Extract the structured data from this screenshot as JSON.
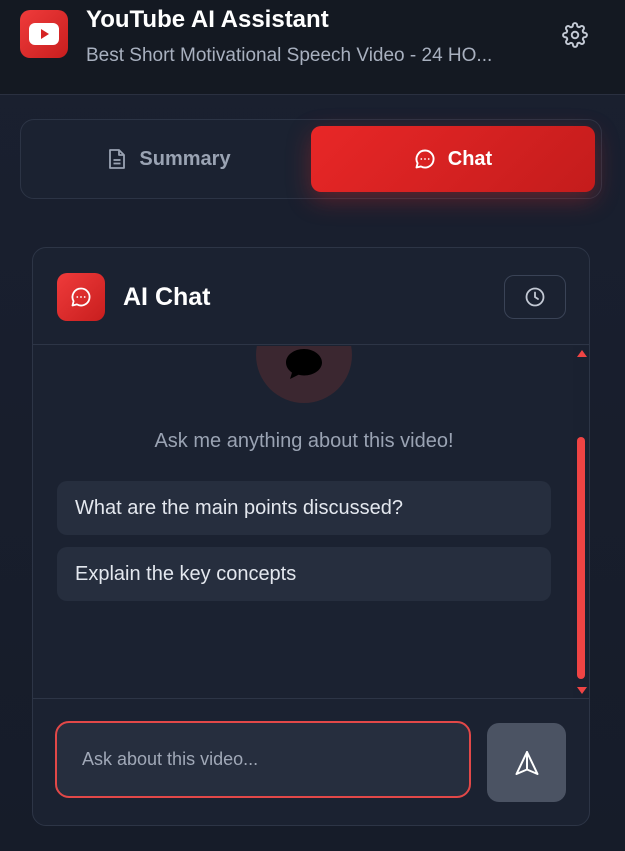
{
  "header": {
    "title": "YouTube AI Assistant",
    "subtitle": "Best Short Motivational Speech Video - 24 HO..."
  },
  "tabs": [
    {
      "label": "Summary",
      "icon": "document-icon",
      "active": false
    },
    {
      "label": "Chat",
      "icon": "chat-bubble-icon",
      "active": true
    }
  ],
  "chat": {
    "title": "AI Chat",
    "welcome": "Ask me anything about this video!",
    "suggestions": [
      "What are the main points discussed?",
      "Explain the key concepts"
    ],
    "input_placeholder": "Ask about this video...",
    "input_value": ""
  },
  "colors": {
    "accent": "#e82727",
    "background": "#1a2030",
    "card": "#1b2231"
  }
}
